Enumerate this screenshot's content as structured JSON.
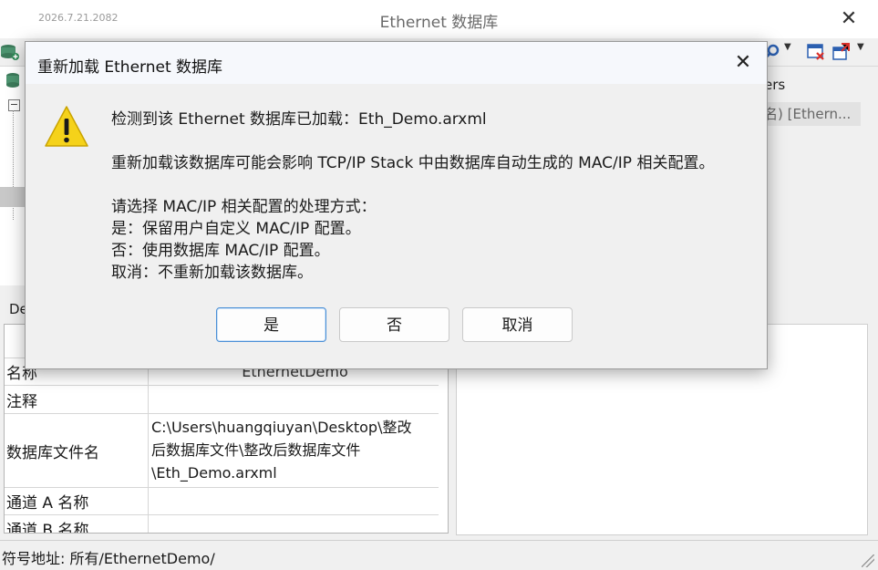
{
  "main_window": {
    "version": "2026.7.21.2082",
    "title": "Ethernet 数据库",
    "right_tab_header": "ers",
    "right_tree_item": "名) [Ethern...",
    "bottom_left_tab": "De",
    "properties": [
      {
        "name": "名称",
        "value": "EthernetDemo"
      },
      {
        "name": "注释",
        "value": ""
      },
      {
        "name": "数据库文件名",
        "value_lines": [
          "C:\\Users\\huangqiuyan\\Desktop\\整改",
          "后数据库文件\\整改后数据库文件",
          "\\Eth_Demo.arxml"
        ]
      },
      {
        "name": "通道 A 名称",
        "value": ""
      },
      {
        "name": "通道 B 名称",
        "value": ""
      }
    ],
    "status_text": "符号地址: 所有/EthernetDemo/"
  },
  "dialog": {
    "title": "重新加载 Ethernet 数据库",
    "lines": [
      "检测到该 Ethernet 数据库已加载：Eth_Demo.arxml",
      "重新加载该数据库可能会影响 TCP/IP Stack 中由数据库自动生成的 MAC/IP 相关配置。",
      "请选择 MAC/IP 相关配置的处理方式：",
      "是：保留用户自定义 MAC/IP 配置。",
      "否：使用数据库 MAC/IP 配置。",
      "取消：不重新加载该数据库。"
    ],
    "buttons": {
      "yes": "是",
      "no": "否",
      "cancel": "取消"
    },
    "warning_icon": "warning-triangle-icon"
  },
  "colors": {
    "warning_yellow": "#f5d21a",
    "default_button_border": "#4a8fd6",
    "selected_row": "#c8c8c8"
  }
}
